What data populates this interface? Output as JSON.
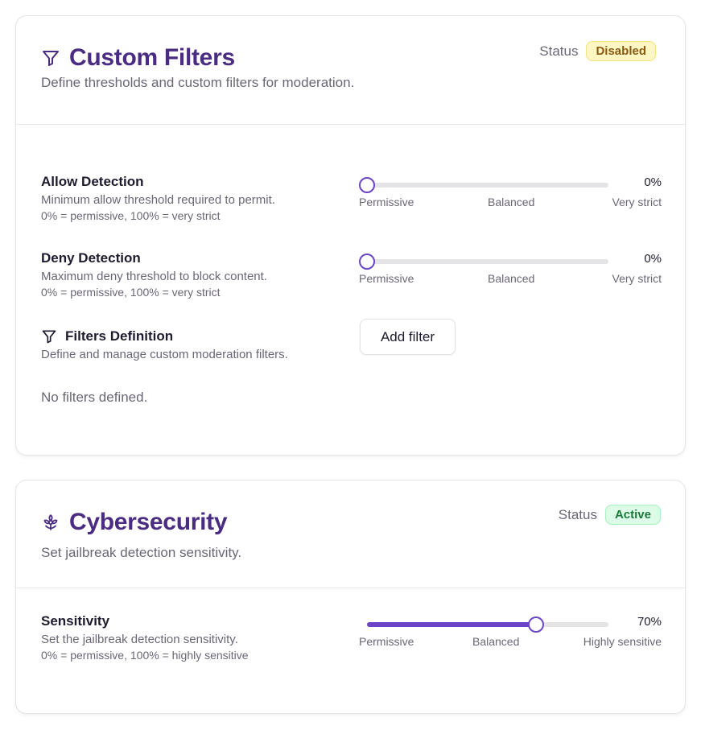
{
  "custom_filters": {
    "title": "Custom Filters",
    "subtitle": "Define thresholds and custom filters for moderation.",
    "status_label": "Status",
    "status_badge": "Disabled",
    "icon": "filter-icon",
    "allow": {
      "title": "Allow Detection",
      "desc": "Minimum allow threshold required to permit.",
      "hint": "0% = permissive, 100% = very strict",
      "value": 0,
      "value_text": "0%",
      "labels": [
        "Permissive",
        "Balanced",
        "Very strict"
      ]
    },
    "deny": {
      "title": "Deny Detection",
      "desc": "Maximum deny threshold to block content.",
      "hint": "0% = permissive, 100% = very strict",
      "value": 0,
      "value_text": "0%",
      "labels": [
        "Permissive",
        "Balanced",
        "Very strict"
      ]
    },
    "filters_def": {
      "title": "Filters Definition",
      "desc": "Define and manage custom moderation filters.",
      "button": "Add filter",
      "empty": "No filters defined."
    }
  },
  "cybersecurity": {
    "title": "Cybersecurity",
    "subtitle": "Set jailbreak detection sensitivity.",
    "status_label": "Status",
    "status_badge": "Active",
    "icon": "biohazard-icon",
    "sensitivity": {
      "title": "Sensitivity",
      "desc": "Set the jailbreak detection sensitivity.",
      "hint": "0% = permissive, 100% = highly sensitive",
      "value": 70,
      "value_text": "70%",
      "labels": [
        "Permissive",
        "Balanced",
        "Highly sensitive"
      ]
    }
  },
  "colors": {
    "accent": "#6a45c8",
    "title": "#4a2c82",
    "badge_disabled": "#fef7c3",
    "badge_active": "#dcfce7"
  }
}
